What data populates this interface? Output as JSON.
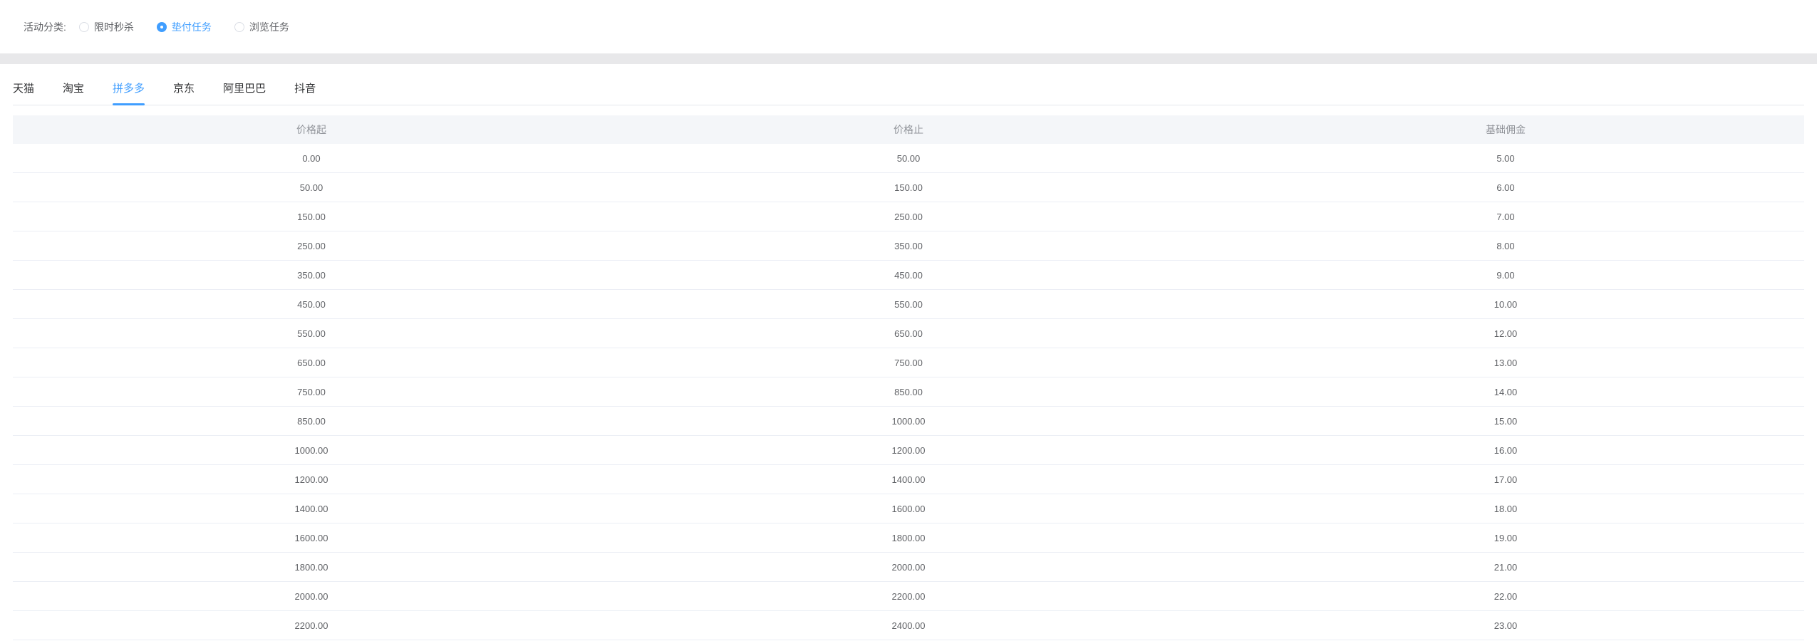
{
  "filter": {
    "label": "活动分类:",
    "options": [
      {
        "name": "flash-sale-radio",
        "label": "限时秒杀",
        "selected": false
      },
      {
        "name": "advance-task-radio",
        "label": "垫付任务",
        "selected": true
      },
      {
        "name": "browse-task-radio",
        "label": "浏览任务",
        "selected": false
      }
    ]
  },
  "tabs": [
    {
      "name": "tab-tmall",
      "label": "天猫",
      "active": false
    },
    {
      "name": "tab-taobao",
      "label": "淘宝",
      "active": false
    },
    {
      "name": "tab-pinduoduo",
      "label": "拼多多",
      "active": true
    },
    {
      "name": "tab-jd",
      "label": "京东",
      "active": false
    },
    {
      "name": "tab-alibaba",
      "label": "阿里巴巴",
      "active": false
    },
    {
      "name": "tab-douyin",
      "label": "抖音",
      "active": false
    }
  ],
  "table": {
    "columns": [
      "价格起",
      "价格止",
      "基础佣金"
    ],
    "rows": [
      [
        "0.00",
        "50.00",
        "5.00"
      ],
      [
        "50.00",
        "150.00",
        "6.00"
      ],
      [
        "150.00",
        "250.00",
        "7.00"
      ],
      [
        "250.00",
        "350.00",
        "8.00"
      ],
      [
        "350.00",
        "450.00",
        "9.00"
      ],
      [
        "450.00",
        "550.00",
        "10.00"
      ],
      [
        "550.00",
        "650.00",
        "12.00"
      ],
      [
        "650.00",
        "750.00",
        "13.00"
      ],
      [
        "750.00",
        "850.00",
        "14.00"
      ],
      [
        "850.00",
        "1000.00",
        "15.00"
      ],
      [
        "1000.00",
        "1200.00",
        "16.00"
      ],
      [
        "1200.00",
        "1400.00",
        "17.00"
      ],
      [
        "1400.00",
        "1600.00",
        "18.00"
      ],
      [
        "1600.00",
        "1800.00",
        "19.00"
      ],
      [
        "1800.00",
        "2000.00",
        "21.00"
      ],
      [
        "2000.00",
        "2200.00",
        "22.00"
      ],
      [
        "2200.00",
        "2400.00",
        "23.00"
      ]
    ]
  },
  "colors": {
    "accent": "#409eff",
    "tab_text": "#303133",
    "cell_text": "#606266",
    "header_text": "#909399",
    "header_bg": "#f4f6f9",
    "row_border": "#ebeef5",
    "separator_bg": "#e8e8ea"
  }
}
